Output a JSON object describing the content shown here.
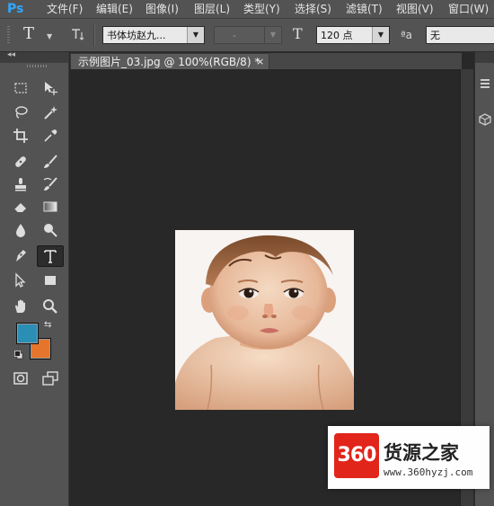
{
  "app": {
    "logo": "Ps"
  },
  "menu": [
    {
      "label": "文件(F)"
    },
    {
      "label": "编辑(E)"
    },
    {
      "label": "图像(I)"
    },
    {
      "label": "图层(L)"
    },
    {
      "label": "类型(Y)"
    },
    {
      "label": "选择(S)"
    },
    {
      "label": "滤镜(T)"
    },
    {
      "label": "视图(V)"
    },
    {
      "label": "窗口(W)"
    }
  ],
  "options": {
    "tool_glyph": "T",
    "font_family": "书体坊赵九...",
    "font_style": "-",
    "size_glyph": "T",
    "font_size": "120 点",
    "aa_glyph": "ªa",
    "antialias": "无"
  },
  "document": {
    "tab_title": "示例图片_03.jpg @ 100%(RGB/8) *",
    "close": "×"
  },
  "tools": {
    "foreground_color": "#2b8eb4",
    "background_color": "#e5752c",
    "active": "type-tool",
    "icons": [
      "marquee-icon",
      "move-icon",
      "lasso-icon",
      "magic-wand-icon",
      "crop-icon",
      "eyedropper-icon",
      "healing-brush-icon",
      "brush-icon",
      "clone-stamp-icon",
      "history-brush-icon",
      "eraser-icon",
      "gradient-icon",
      "blur-icon",
      "dodge-icon",
      "pen-icon",
      "type-icon",
      "path-selection-icon",
      "rectangle-icon",
      "hand-icon",
      "zoom-icon"
    ]
  },
  "watermark": {
    "logo_text": "360",
    "name": "货源之家",
    "url": "www.360hyzj.com"
  }
}
